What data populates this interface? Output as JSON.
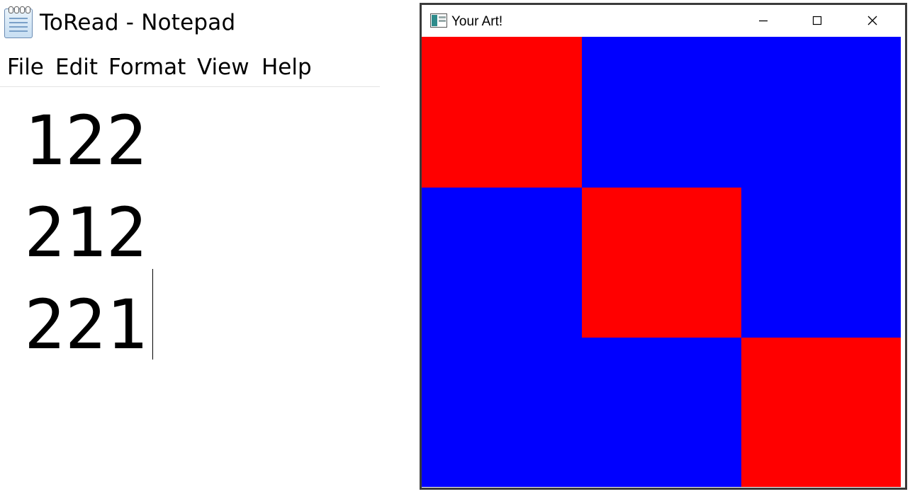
{
  "notepad": {
    "title": "ToRead - Notepad",
    "menu": [
      {
        "label": "File"
      },
      {
        "label": "Edit"
      },
      {
        "label": "Format"
      },
      {
        "label": "View"
      },
      {
        "label": "Help"
      }
    ],
    "lines": [
      "122",
      "212",
      "221"
    ],
    "icon": "notepad-icon"
  },
  "art_window": {
    "title": "Your Art!",
    "icon": "app-window-icon",
    "controls": [
      "minimize-icon",
      "maximize-icon",
      "close-icon"
    ],
    "grid": [
      [
        "red",
        "blue",
        "blue"
      ],
      [
        "blue",
        "red",
        "blue"
      ],
      [
        "blue",
        "blue",
        "red"
      ]
    ],
    "colors": {
      "red": "#ff0000",
      "blue": "#0000ff"
    }
  }
}
